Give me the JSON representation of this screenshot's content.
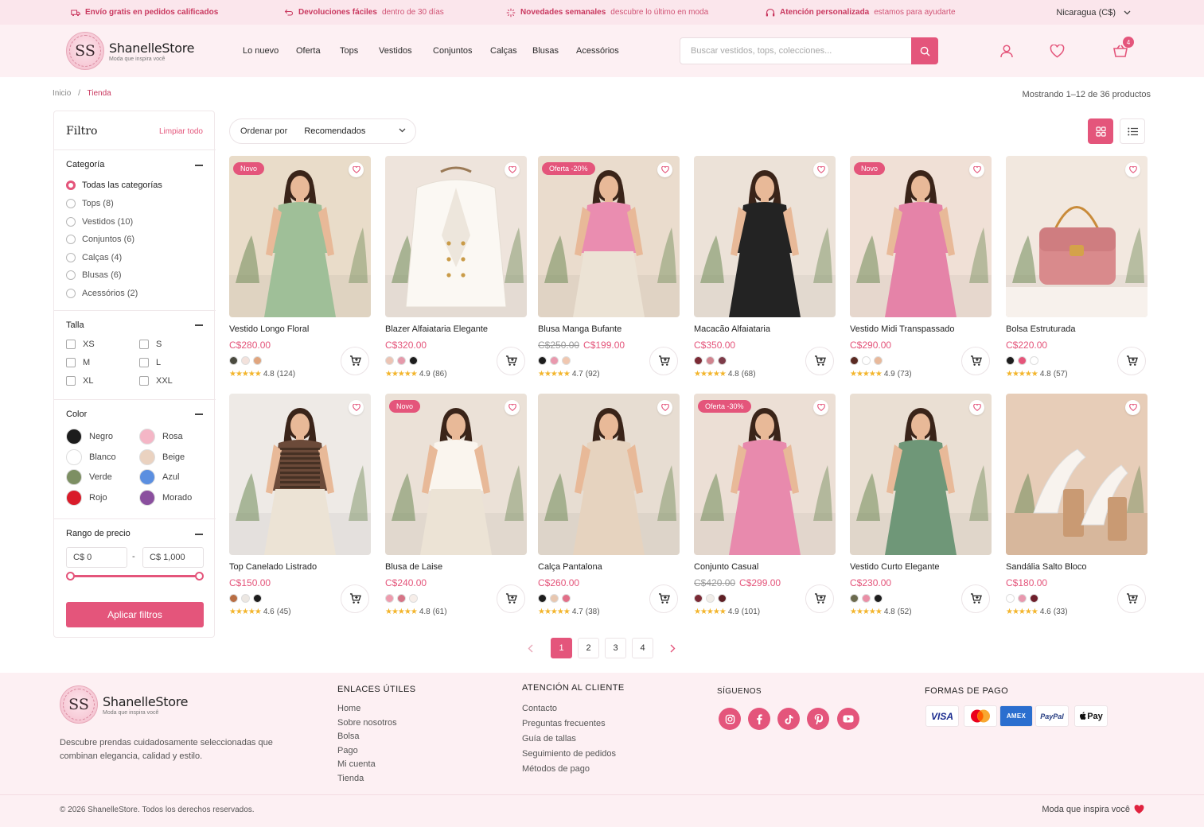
{
  "topbar": {
    "promos": [
      {
        "bold": "Envío gratis en pedidos calificados",
        "rest": "",
        "icon": "truck-icon"
      },
      {
        "bold": "Devoluciones fáciles",
        "rest": "dentro de 30 días",
        "icon": "return-icon"
      },
      {
        "bold": "Novedades semanales",
        "rest": "descubre lo último en moda",
        "icon": "sparkle-icon"
      },
      {
        "bold": "Atención personalizada",
        "rest": "estamos para ayudarte",
        "icon": "headset-icon"
      }
    ],
    "country": "Nicaragua (C$)"
  },
  "brand": {
    "name": "ShanelleStore",
    "initials": "SS",
    "tagline": "Moda que inspira você"
  },
  "nav": [
    "Lo nuevo",
    "Oferta",
    "Tops",
    "Vestidos",
    "Conjuntos",
    "Calças",
    "Blusas",
    "Acessórios"
  ],
  "search": {
    "placeholder": "Buscar vestidos, tops, colecciones..."
  },
  "cart": {
    "count": "4"
  },
  "breadcrumb": {
    "home": "Inicio",
    "sep": "/",
    "current": "Tienda"
  },
  "results": "Mostrando 1–12 de 36 productos",
  "filter": {
    "title": "Filtro",
    "clear": "Limpiar todo",
    "category": {
      "title": "Categoría",
      "items": [
        "Todas las categorías",
        "Tops (8)",
        "Vestidos (10)",
        "Conjuntos (6)",
        "Calças (4)",
        "Blusas (6)",
        "Acessórios (2)"
      ],
      "selected": 0
    },
    "size": {
      "title": "Talla",
      "items": [
        "XS",
        "S",
        "M",
        "L",
        "XL",
        "XXL"
      ]
    },
    "color": {
      "title": "Color",
      "items": [
        {
          "name": "Negro",
          "hex": "#1c1c1c"
        },
        {
          "name": "Rosa",
          "hex": "#f4b6c6"
        },
        {
          "name": "Blanco",
          "hex": "#ffffff"
        },
        {
          "name": "Beige",
          "hex": "#ead2c0"
        },
        {
          "name": "Verde",
          "hex": "#7d8f63"
        },
        {
          "name": "Azul",
          "hex": "#5b8fe0"
        },
        {
          "name": "Rojo",
          "hex": "#d91c2a"
        },
        {
          "name": "Morado",
          "hex": "#8a4f9e"
        }
      ]
    },
    "price": {
      "title": "Rango de precio",
      "min": "C$ 0",
      "max": "C$ 1,000",
      "dash": "-"
    },
    "apply": "Aplicar filtros"
  },
  "sort": {
    "label": "Ordenar por",
    "value": "Recomendados"
  },
  "products": [
    {
      "name": "Vestido Longo Floral",
      "price": "C$280.00",
      "old": "",
      "tag": "Novo",
      "rating": "4.8",
      "reviews": "(124)",
      "colors": [
        "#4a4a3f",
        "#f3e2dc",
        "#e0a57e"
      ],
      "bg": "#e9dcc9",
      "dress": "#9fbf98"
    },
    {
      "name": "Blazer Alfaiataria Elegante",
      "price": "C$320.00",
      "old": "",
      "tag": "",
      "rating": "4.9",
      "reviews": "(86)",
      "colors": [
        "#ecc4b4",
        "#e59aab",
        "#1d1d1d"
      ],
      "bg": "#eee4dc",
      "dress": "#fbf8f3"
    },
    {
      "name": "Blusa Manga Bufante",
      "price": "C$199.00",
      "old": "C$250.00",
      "tag": "Oferta -20%",
      "rating": "4.7",
      "reviews": "(92)",
      "colors": [
        "#1d1d1d",
        "#e999ae",
        "#f0c7b0"
      ],
      "bg": "#eadccd",
      "dress": "#ea8db0"
    },
    {
      "name": "Macacão Alfaiataria",
      "price": "C$350.00",
      "old": "",
      "tag": "",
      "rating": "4.8",
      "reviews": "(68)",
      "colors": [
        "#7a2a35",
        "#d0848f",
        "#7d3b49"
      ],
      "bg": "#ece2d8",
      "dress": "#232323"
    },
    {
      "name": "Vestido Midi Transpassado",
      "price": "C$290.00",
      "old": "",
      "tag": "Novo",
      "rating": "4.9",
      "reviews": "(73)",
      "colors": [
        "#5a2a22",
        "#ffffff",
        "#e8b99b"
      ],
      "bg": "#f0e0d6",
      "dress": "#e583a8"
    },
    {
      "name": "Bolsa Estruturada",
      "price": "C$220.00",
      "old": "",
      "tag": "",
      "rating": "4.8",
      "reviews": "(57)",
      "colors": [
        "#1d1d1d",
        "#e5557a",
        "#ffffff"
      ],
      "bg": "#f2e8df",
      "dress": "#d98a8c"
    },
    {
      "name": "Top Canelado Listrado",
      "price": "C$150.00",
      "old": "",
      "tag": "",
      "rating": "4.6",
      "reviews": "(45)",
      "colors": [
        "#b86d43",
        "#ece7e2",
        "#1d1d1d"
      ],
      "bg": "#eeeae6",
      "dress": "#6b4a39"
    },
    {
      "name": "Blusa de Laise",
      "price": "C$240.00",
      "old": "",
      "tag": "Novo",
      "rating": "4.8",
      "reviews": "(61)",
      "colors": [
        "#ee9cae",
        "#d67486",
        "#f7eee9"
      ],
      "bg": "#ebe1d7",
      "dress": "#faf5ee"
    },
    {
      "name": "Calça Pantalona",
      "price": "C$260.00",
      "old": "",
      "tag": "",
      "rating": "4.7",
      "reviews": "(38)",
      "colors": [
        "#1d1d1d",
        "#e8c7b0",
        "#e26f88"
      ],
      "bg": "#e7ddd2",
      "dress": "#e6d3bf"
    },
    {
      "name": "Conjunto Casual",
      "price": "C$299.00",
      "old": "C$420.00",
      "tag": "Oferta -30%",
      "rating": "4.9",
      "reviews": "(101)",
      "colors": [
        "#7a2a35",
        "#f1ede8",
        "#5e1f25"
      ],
      "bg": "#ecdfd5",
      "dress": "#e88aad"
    },
    {
      "name": "Vestido Curto Elegante",
      "price": "C$230.00",
      "old": "",
      "tag": "",
      "rating": "4.8",
      "reviews": "(52)",
      "colors": [
        "#6b6a4e",
        "#ea8fa6",
        "#1d1d1d"
      ],
      "bg": "#eadfd3",
      "dress": "#6f9778"
    },
    {
      "name": "Sandália Salto Bloco",
      "price": "C$180.00",
      "old": "",
      "tag": "",
      "rating": "4.6",
      "reviews": "(33)",
      "colors": [
        "#ffffff",
        "#e898ae",
        "#6e1f2b"
      ],
      "bg": "#e7cdb8",
      "dress": "#f8f3ee"
    }
  ],
  "pagination": [
    "1",
    "2",
    "3",
    "4"
  ],
  "footer": {
    "description": "Descubre prendas cuidadosamente seleccionadas que combinan elegancia, calidad y estilo.",
    "links_title": "ENLACES ÚTILES",
    "links": [
      "Home",
      "Sobre nosotros",
      "Bolsa",
      "Pago",
      "Mi cuenta",
      "Tienda"
    ],
    "support_title": "ATENCIÓN AL CLIENTE",
    "support": [
      "Contacto",
      "Preguntas frecuentes",
      "Guía de tallas",
      "Seguimiento de pedidos",
      "Métodos de pago"
    ],
    "social_title": "SÍGUENOS",
    "social": [
      "instagram-icon",
      "facebook-icon",
      "tiktok-icon",
      "pinterest-icon",
      "youtube-icon"
    ],
    "pay_title": "FORMAS DE PAGO",
    "payments": [
      "VISA",
      "Mastercard",
      "AMEX",
      "PayPal",
      "Pay"
    ],
    "copyright": "© 2026 ShanelleStore. Todos los derechos reservados.",
    "motto": "Moda que inspira você"
  },
  "colors": {
    "accent": "#e4557b",
    "topbar_bg": "#fbe6ec",
    "footer_bg": "#fdf0f3"
  }
}
